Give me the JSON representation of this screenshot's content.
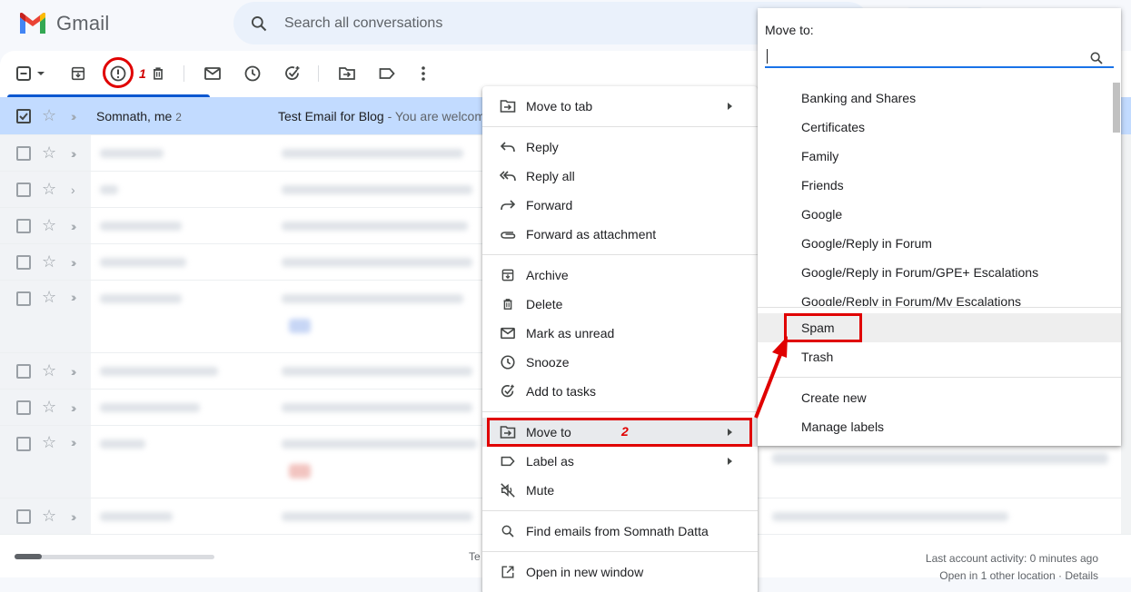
{
  "header": {
    "app_name": "Gmail",
    "search_placeholder": "Search all conversations"
  },
  "annotations": {
    "step1": "1",
    "step2": "2"
  },
  "email_list": {
    "selected_row": {
      "sender": "Somnath, me",
      "count": "2",
      "subject": "Test Email for Blog",
      "snippet": " - You are welcom"
    }
  },
  "context_menu": {
    "items": [
      {
        "label": "Move to tab",
        "icon": "move-to-tab-icon",
        "submenu": true
      },
      {
        "label": "Reply",
        "icon": "reply-icon"
      },
      {
        "label": "Reply all",
        "icon": "reply-all-icon"
      },
      {
        "label": "Forward",
        "icon": "forward-icon"
      },
      {
        "label": "Forward as attachment",
        "icon": "attachment-icon"
      },
      {
        "label": "Archive",
        "icon": "archive-icon"
      },
      {
        "label": "Delete",
        "icon": "trash-icon"
      },
      {
        "label": "Mark as unread",
        "icon": "mail-icon"
      },
      {
        "label": "Snooze",
        "icon": "clock-icon"
      },
      {
        "label": "Add to tasks",
        "icon": "add-task-icon"
      },
      {
        "label": "Move to",
        "icon": "move-to-icon",
        "submenu": true
      },
      {
        "label": "Label as",
        "icon": "label-icon",
        "submenu": true
      },
      {
        "label": "Mute",
        "icon": "mute-icon"
      },
      {
        "label": "Find emails from Somnath Datta",
        "icon": "search-icon"
      },
      {
        "label": "Open in new window",
        "icon": "open-new-window-icon"
      }
    ]
  },
  "move_to_menu": {
    "title": "Move to:",
    "folders": [
      "Banking and Shares",
      "Certificates",
      "Family",
      "Friends",
      "Google",
      "Google/Reply in Forum",
      "Google/Reply in Forum/GPE+ Escalations",
      "Google/Reply in Forum/My Escalations"
    ],
    "system": [
      "Spam",
      "Trash"
    ],
    "actions": [
      "Create new",
      "Manage labels"
    ]
  },
  "footer": {
    "left_text": "Te",
    "activity": "Last account activity: 0 minutes ago",
    "other_location": "Open in 1 other location · Details"
  },
  "colors": {
    "annotation": "#e00000",
    "selected_row": "#c2dbff",
    "accent": "#1a73e8"
  }
}
